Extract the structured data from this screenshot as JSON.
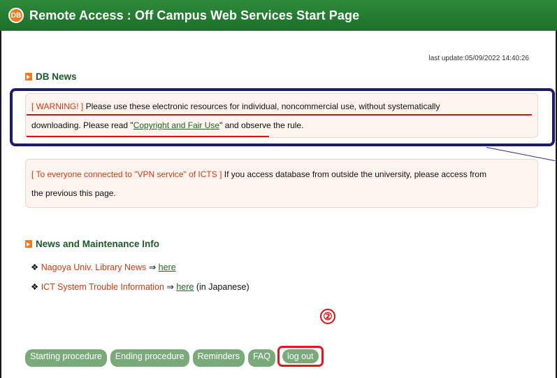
{
  "header": {
    "logo": "DB",
    "title": "Remote Access : Off Campus Web Services Start Page"
  },
  "last_update": "last update:05/09/2022 14:40:26",
  "db_news": {
    "heading": "DB News",
    "warning": {
      "tag": "[ WARNING! ]",
      "text1": " Please use these electronic resources for individual, noncommercial use, without systematically",
      "text2a": "downloading. Please read \"",
      "link": "Copyright and Fair Use",
      "text2b": "\" and observe the rule."
    },
    "vpn": {
      "tag": "[ To everyone connected to \"VPN service\" of ICTS ]",
      "text1": " If you access database from outside the university, please access from",
      "text2": "the previous this page."
    }
  },
  "maintenance": {
    "heading": "News and Maintenance Info",
    "items": [
      {
        "bullet": "❖",
        "label": "Nagoya Univ. Library News",
        "arrow": " ⇒ ",
        "link": "here",
        "suffix": ""
      },
      {
        "bullet": "❖",
        "label": "ICT System Trouble Information",
        "arrow": " ⇒ ",
        "link": "here",
        "suffix": " (in Japanese)"
      }
    ]
  },
  "annotation_number": "②",
  "buttons": {
    "starting": "Starting procedure",
    "ending": "Ending procedure",
    "reminders": "Reminders",
    "faq": "FAQ",
    "logout": "log out"
  },
  "colors": {
    "header": "#1d6f2a",
    "accent": "#f07a20",
    "warning": "#d33a10",
    "annotation": "#e01010",
    "frame": "#1d1c6a"
  }
}
